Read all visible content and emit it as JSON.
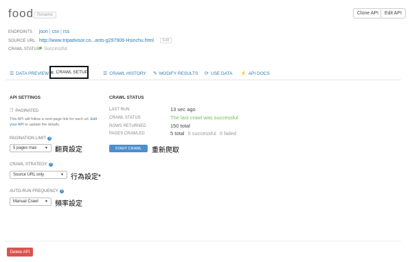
{
  "api": {
    "title": "food",
    "rename_label": "Rename",
    "clone_label": "Clone API",
    "edit_label": "Edit API"
  },
  "meta": {
    "endpoints_label": "ENDPOINTS",
    "endpoints": [
      "json",
      "csv",
      "rss"
    ],
    "sep": "|",
    "source_url_label": "SOURCE URL",
    "source_url": "http://www.tripadvisor.co...ants-g297906-Hsinchu.html",
    "edit_label": "Edit",
    "crawl_status_label": "CRAWL STATUS",
    "crawl_status": "Successful"
  },
  "tabs": [
    {
      "label": "Data Preview",
      "icon": "list-icon"
    },
    {
      "label": "Crawl Setup",
      "icon": "gear-icon",
      "active": true
    },
    {
      "label": "Crawl History",
      "icon": "list-icon"
    },
    {
      "label": "Modify Results",
      "icon": "pencil-icon"
    },
    {
      "label": "Use Data",
      "icon": "refresh-icon"
    },
    {
      "label": "API Docs",
      "icon": "plug-icon"
    }
  ],
  "settings": {
    "heading": "API SETTINGS",
    "paginated_label": "PAGINATED",
    "help_text_pre": "This API will follow a next-page link for each url.",
    "help_link": "Edit your API",
    "help_text_post": "to update the details.",
    "pagination_limit_label": "PAGINATION LIMIT",
    "pagination_limit_value": "5 pages max",
    "pagination_note": "翻頁設定",
    "crawl_strategy_label": "CRAWL STRATEGY",
    "crawl_strategy_value": "Source URL only",
    "crawl_strategy_note": "行為設定*",
    "auto_run_label": "AUTO-RUN FREQUENCY",
    "auto_run_value": "Manual Crawl",
    "auto_run_note": "頻率設定"
  },
  "crawl_status": {
    "heading": "CRAWL STATUS",
    "rows": [
      {
        "k": "LAST RUN",
        "v": "13 sec ago"
      },
      {
        "k": "CRAWL STATUS",
        "v": "The last crawl was successful"
      },
      {
        "k": "ROWS RETURNED",
        "v": "150 total"
      },
      {
        "k": "PAGES CRAWLED",
        "v": "5 total"
      }
    ],
    "pages_successful": "5 successful",
    "pages_failed": "0 failed",
    "start_crawl_label": "START CRAWL",
    "start_crawl_note": "重新爬取"
  },
  "footer": {
    "delete_label": "Delete API"
  },
  "colors": {
    "link": "#2a7ab0",
    "success": "#6cbf5a",
    "primary": "#4a8fcf",
    "danger": "#d9534f"
  }
}
